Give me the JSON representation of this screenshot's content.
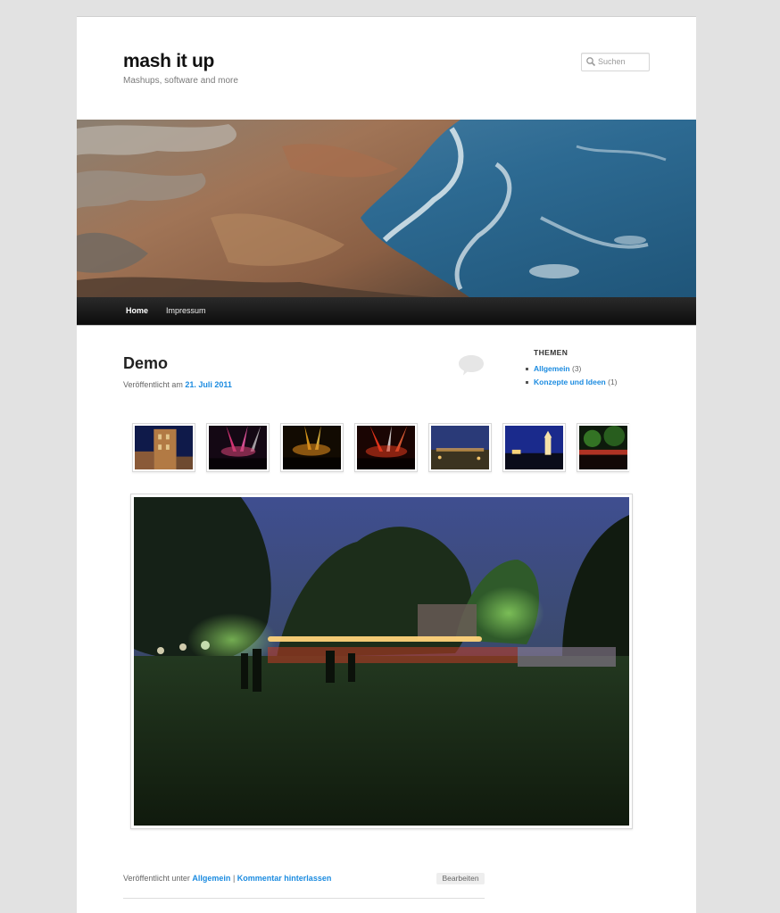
{
  "site": {
    "title": "mash it up",
    "description": "Mashups, software and more"
  },
  "search": {
    "placeholder": "Suchen"
  },
  "nav": {
    "home_label": "Home",
    "impressum_label": "Impressum"
  },
  "post": {
    "title": "Demo",
    "meta_prefix": "Veröffentlicht am",
    "date": "21. Juli 2011"
  },
  "sidebar": {
    "widget_title": "THEMEN",
    "categories": [
      {
        "name": "Allgemein",
        "count": "(3)"
      },
      {
        "name": "Konzepte und Ideen",
        "count": "(1)"
      }
    ]
  },
  "gallery": {
    "thumbnails": [
      "tower",
      "concert-pink",
      "concert-yellow",
      "concert-red",
      "night-field",
      "night-castle",
      "night-lights"
    ],
    "selected": "night-park"
  },
  "footer": {
    "prefix": "Veröffentlicht unter",
    "category": "Allgemein",
    "separator": "|",
    "comment_link": "Kommentar hinterlassen",
    "edit_label": "Bearbeiten"
  },
  "colors": {
    "link": "#1b8be0",
    "nav_bar": "#111111",
    "page_background": "#e2e2e2"
  }
}
